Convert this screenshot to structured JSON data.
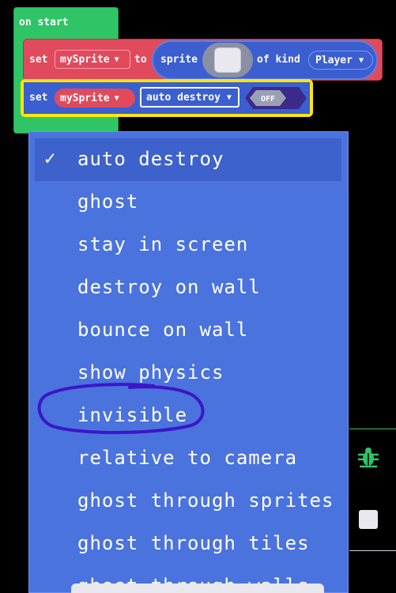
{
  "blocks": {
    "on_start_label": "on start",
    "set_label": "set",
    "sprite_var": "mySprite",
    "to_label": "to",
    "sprite_label": "sprite",
    "of_kind_label": "of kind",
    "kind_value": "Player",
    "set2_label": "set",
    "sprite_var2": "mySprite",
    "flag_value": "auto destroy",
    "toggle_value": "OFF"
  },
  "menu": {
    "check_icon": "✓",
    "items": [
      "auto destroy",
      "ghost",
      "stay in screen",
      "destroy on wall",
      "bounce on wall",
      "show physics",
      "invisible",
      "relative to camera",
      "ghost through sprites",
      "ghost through tiles",
      "ghost through walls"
    ],
    "selected_index": 0
  },
  "annotation": {
    "circle_color": "#3d16c8"
  },
  "icons": {
    "debug": "bug-icon",
    "stop": "stop-icon"
  },
  "colors": {
    "background": "#000000",
    "on_start": "#2fc566",
    "sprite_block": "#e14a5d",
    "sprite_round": "#3b5fd0",
    "menu": "#4a73de",
    "highlight": "#ffe600"
  }
}
